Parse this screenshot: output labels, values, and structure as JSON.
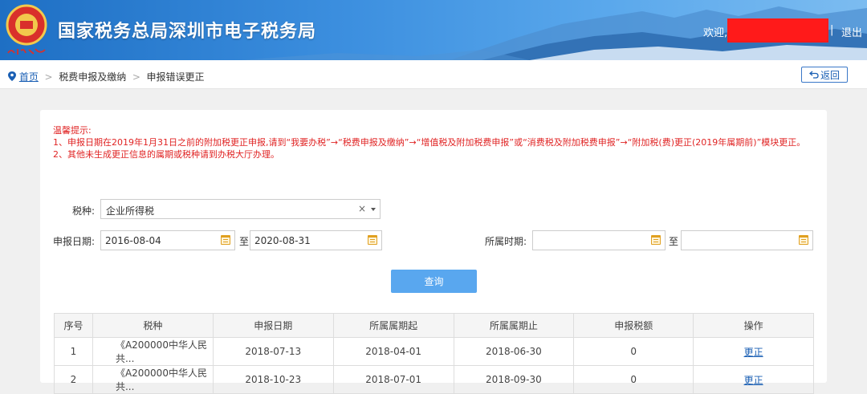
{
  "header": {
    "title": "国家税务总局深圳市电子税务局",
    "welcome": "欢迎,",
    "separator": "|",
    "logout": "退出"
  },
  "breadcrumb": {
    "home": "首页",
    "sep": ">",
    "level1": "税费申报及缴纳",
    "level2": "申报错误更正"
  },
  "back_button": "返回",
  "tips": [
    "温馨提示:",
    "1、申报日期在2019年1月31日之前的附加税更正申报,请到“我要办税”→“税费申报及缴纳”→“增值税及附加税费申报”或“消费税及附加税费申报”→“附加税(费)更正(2019年属期前)”模块更正。",
    "2、其他未生成更正信息的属期或税种请到办税大厅办理。"
  ],
  "form": {
    "tax_type_label": "税种:",
    "tax_type_value": "企业所得税",
    "clear": "×",
    "declare_date_label": "申报日期:",
    "declare_from": "2016-08-04",
    "to": "至",
    "declare_to": "2020-08-31",
    "period_label": "所属时期:",
    "period_from": "",
    "period_to": "",
    "query_button": "查询"
  },
  "table": {
    "headers": [
      "序号",
      "税种",
      "申报日期",
      "所属属期起",
      "所属属期止",
      "申报税额",
      "操作"
    ],
    "rows": [
      [
        "1",
        "《A200000中华人民共...",
        "2018-07-13",
        "2018-04-01",
        "2018-06-30",
        "0",
        "更正"
      ],
      [
        "2",
        "《A200000中华人民共...",
        "2018-10-23",
        "2018-07-01",
        "2018-09-30",
        "0",
        "更正"
      ]
    ]
  },
  "colors": {
    "header_blue": "#1e6fc4",
    "tip_red": "#e02424",
    "button_blue": "#59a7ef",
    "link_blue": "#1a5fb4"
  }
}
